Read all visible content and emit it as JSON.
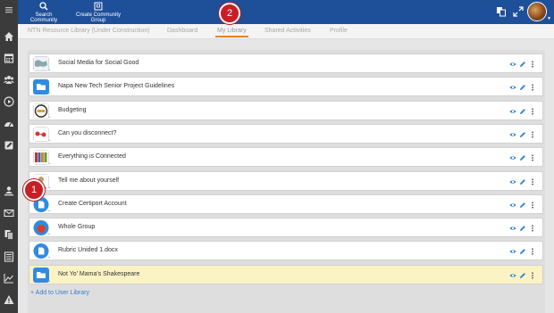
{
  "colors": {
    "sidebar": "#3b3b3b",
    "topbar": "#1e4f99",
    "active_tab_underline": "#e8821e",
    "callout": "#c71f25",
    "link": "#2f7fd6",
    "highlight_row": "#fbf3c4"
  },
  "sidebar": {
    "icons": [
      "menu-icon",
      "home-icon",
      "calendar-icon",
      "groups-icon",
      "play-icon",
      "dashboard-icon",
      "edit-icon",
      "user-library-icon",
      "mail-icon",
      "documents-icon",
      "list-icon",
      "chart-icon",
      "alert-icon"
    ]
  },
  "topbar": {
    "search_label": "Search Community",
    "create_label": "Create Community Group"
  },
  "tabs": [
    {
      "label": "NTN Resource Library (Under Construction)"
    },
    {
      "label": "Dashboard"
    },
    {
      "label": "My Library",
      "active": true
    },
    {
      "label": "Shared Activities"
    },
    {
      "label": "Profile"
    }
  ],
  "library_items": [
    {
      "title": "Social Media for Social Good",
      "thumb": "map"
    },
    {
      "title": "Napa New Tech Senior Project Guidelines",
      "thumb": "folder"
    },
    {
      "title": "Budgeting",
      "thumb": "money"
    },
    {
      "title": "Can you disconnect?",
      "thumb": "cartoon"
    },
    {
      "title": "Everything is Connected",
      "thumb": "books"
    },
    {
      "title": "Tell me about yourself",
      "thumb": "person"
    },
    {
      "title": "Create Certiport Account",
      "thumb": "document"
    },
    {
      "title": "Whole Group",
      "thumb": "apple"
    },
    {
      "title": "Rubric Unided 1.docx",
      "thumb": "document"
    },
    {
      "title": "Not Yo' Mama's Shakespeare",
      "thumb": "folder",
      "highlight": true
    }
  ],
  "add_link": "+ Add to User Library",
  "callouts": {
    "one": "1",
    "two": "2"
  }
}
